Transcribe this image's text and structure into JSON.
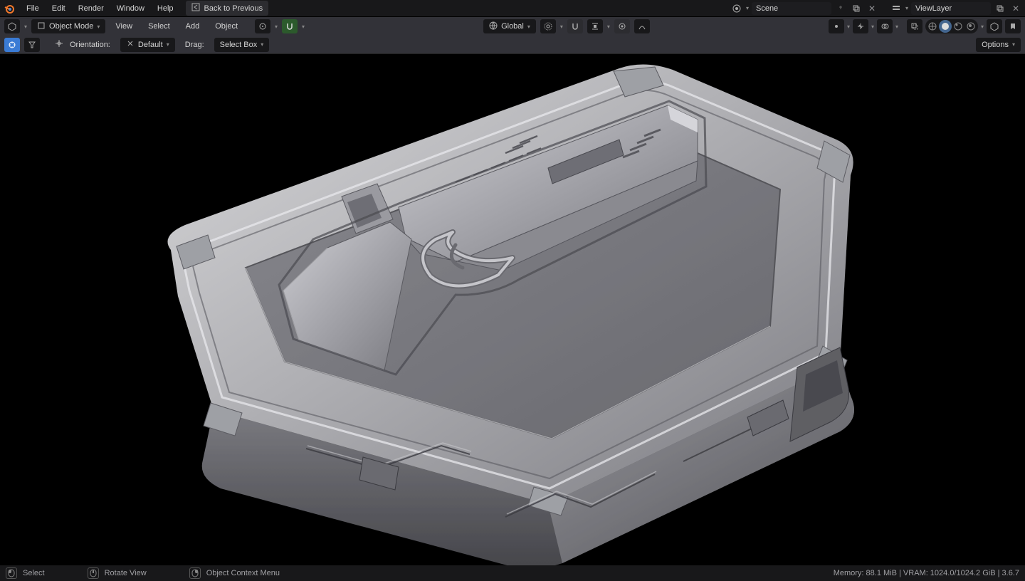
{
  "topbar": {
    "menus": [
      "File",
      "Edit",
      "Render",
      "Window",
      "Help"
    ],
    "back_btn": "Back to Previous",
    "scene_field": "Scene",
    "viewlayer_field": "ViewLayer"
  },
  "header2": {
    "mode": "Object Mode",
    "menus": [
      "View",
      "Select",
      "Add",
      "Object"
    ],
    "orientation": "Global"
  },
  "header3": {
    "orientation_label": "Orientation:",
    "orientation_value": "Default",
    "drag_label": "Drag:",
    "drag_value": "Select Box",
    "options": "Options"
  },
  "statusbar": {
    "left_items": [
      {
        "icon": "mouse-left",
        "label": "Select"
      },
      {
        "icon": "mouse-middle",
        "label": "Rotate View"
      },
      {
        "icon": "mouse-right",
        "label": "Object Context Menu"
      }
    ],
    "right": "Memory: 88.1 MiB | VRAM: 1024.0/1024.2 GiB | 3.6.7"
  }
}
